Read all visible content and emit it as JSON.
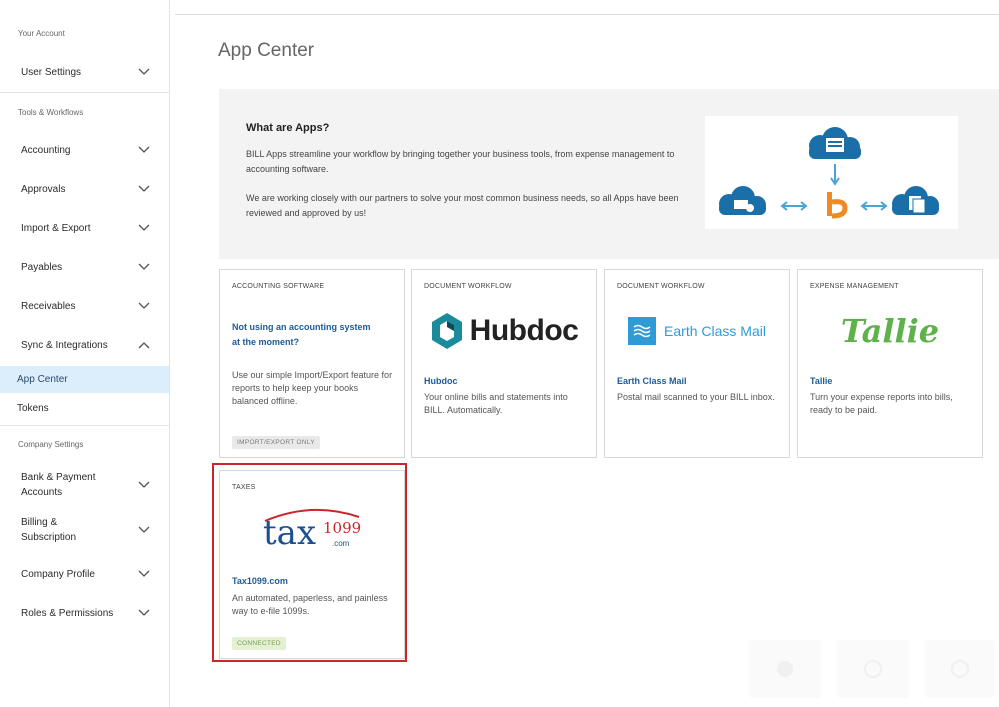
{
  "sidebar": {
    "section_account": "Your Account",
    "user_settings": "User Settings",
    "section_tools": "Tools & Workflows",
    "accounting": "Accounting",
    "approvals": "Approvals",
    "import_export": "Import & Export",
    "payables": "Payables",
    "receivables": "Receivables",
    "sync_integrations": "Sync & Integrations",
    "app_center": "App Center",
    "tokens": "Tokens",
    "section_company": "Company Settings",
    "bank_payment_line1": "Bank & Payment",
    "bank_payment_line2": "Accounts",
    "billing_line1": "Billing &",
    "billing_line2": "Subscription",
    "company_profile": "Company Profile",
    "roles_permissions": "Roles & Permissions"
  },
  "page": {
    "title": "App Center"
  },
  "info": {
    "title": "What are Apps?",
    "paragraph1": "BILL Apps streamline your workflow by bringing together your business tools, from expense management to accounting software.",
    "paragraph2": "We are working closely with our partners to solve your most common business needs, so all Apps have been reviewed and approved by us!"
  },
  "cards": [
    {
      "category": "ACCOUNTING SOFTWARE",
      "headline": "Not using an accounting system at the moment?",
      "description": "Use our simple Import/Export feature for reports to help keep your books balanced offline.",
      "badge": "IMPORT/EXPORT ONLY"
    },
    {
      "category": "DOCUMENT WORKFLOW",
      "logo_text": "Hubdoc",
      "name": "Hubdoc",
      "description": "Your online bills and statements into BILL. Automatically."
    },
    {
      "category": "DOCUMENT WORKFLOW",
      "logo_text": "Earth Class Mail",
      "name": "Earth Class Mail",
      "description": "Postal mail scanned to your BILL inbox."
    },
    {
      "category": "EXPENSE MANAGEMENT",
      "logo_text": "Tallie",
      "name": "Tallie",
      "description": "Turn your expense reports into bills, ready to be paid."
    },
    {
      "category": "TAXES",
      "logo_text_main": "tax",
      "logo_text_num": "1099",
      "logo_text_dom": ".com",
      "name": "Tax1099.com",
      "description": "An automated, paperless, and painless way to e-file 1099s.",
      "badge": "CONNECTED"
    }
  ],
  "colors": {
    "link": "#1f5b98",
    "active_bg": "#dceefb",
    "highlight_border": "#c8262b",
    "hubdoc_teal": "#1b8a9b",
    "tallie_green": "#5fb14b",
    "ecm_blue": "#2f9bd6",
    "cloud_blue": "#1a6fa8",
    "bill_orange": "#f08a24"
  },
  "icons": {
    "chevron": "chevron-down-icon",
    "chevron_up": "chevron-up-icon"
  }
}
